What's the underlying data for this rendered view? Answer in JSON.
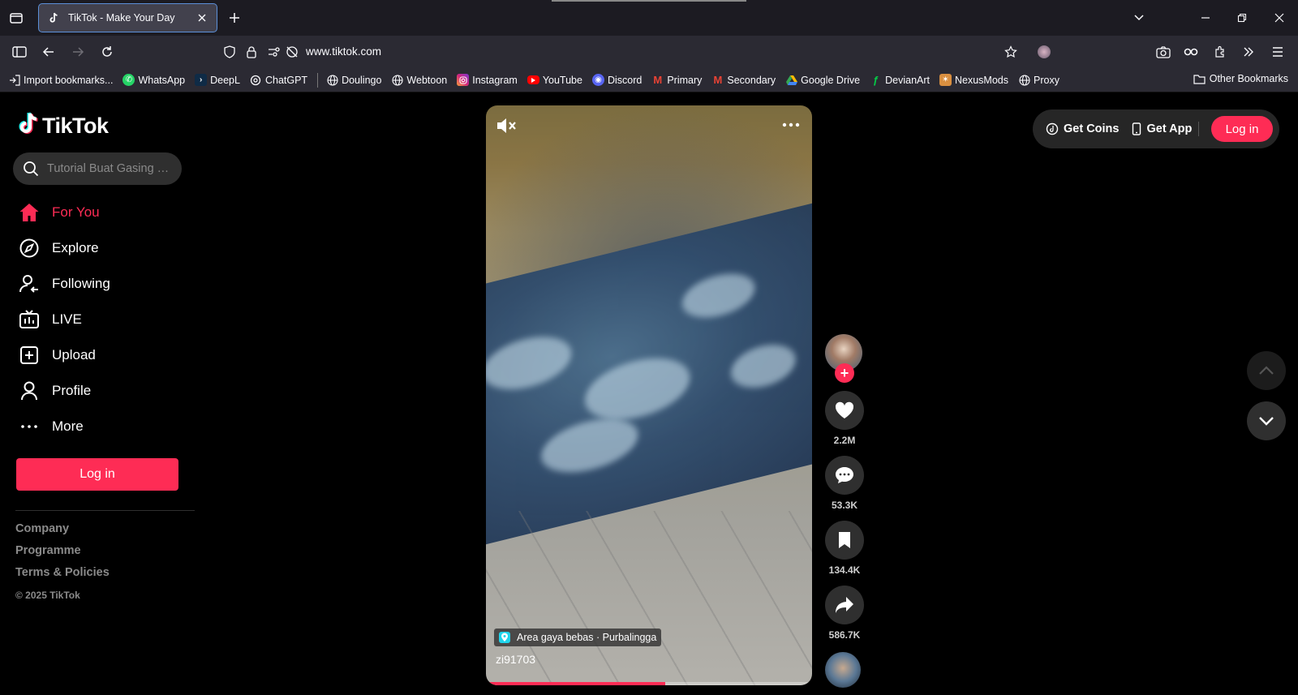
{
  "browser": {
    "tab_title": "TikTok - Make Your Day",
    "url": "www.tiktok.com",
    "bookmarks": [
      {
        "label": "Import bookmarks...",
        "icon": "import-icon"
      },
      {
        "label": "WhatsApp",
        "icon": "whatsapp-icon"
      },
      {
        "label": "DeepL",
        "icon": "deepl-icon"
      },
      {
        "label": "ChatGPT",
        "icon": "chatgpt-icon"
      },
      {
        "label": "Doulingo",
        "icon": "globe-icon"
      },
      {
        "label": "Webtoon",
        "icon": "globe-icon"
      },
      {
        "label": "Instagram",
        "icon": "instagram-icon"
      },
      {
        "label": "YouTube",
        "icon": "youtube-icon"
      },
      {
        "label": "Discord",
        "icon": "discord-icon"
      },
      {
        "label": "Primary",
        "icon": "gmail-icon"
      },
      {
        "label": "Secondary",
        "icon": "gmail-icon"
      },
      {
        "label": "Google Drive",
        "icon": "google-drive-icon"
      },
      {
        "label": "DevianArt",
        "icon": "deviantart-icon"
      },
      {
        "label": "NexusMods",
        "icon": "nexusmods-icon"
      },
      {
        "label": "Proxy",
        "icon": "globe-icon"
      }
    ],
    "other_bookmarks": "Other Bookmarks"
  },
  "sidebar": {
    "logo": "TikTok",
    "search_placeholder": "Tutorial Buat Gasing P...",
    "nav": [
      {
        "label": "For You",
        "icon": "home-icon",
        "active": true
      },
      {
        "label": "Explore",
        "icon": "compass-icon"
      },
      {
        "label": "Following",
        "icon": "following-icon"
      },
      {
        "label": "LIVE",
        "icon": "live-icon"
      },
      {
        "label": "Upload",
        "icon": "upload-icon"
      },
      {
        "label": "Profile",
        "icon": "profile-icon"
      },
      {
        "label": "More",
        "icon": "more-icon"
      }
    ],
    "login": "Log in",
    "footer": {
      "links": [
        "Company",
        "Programme",
        "Terms & Policies"
      ],
      "copyright": "© 2025 TikTok"
    }
  },
  "video": {
    "location": "Area gaya bebas · Purbalingga",
    "username": "zi91703",
    "progress": 0.55
  },
  "actions": {
    "likes": "2.2M",
    "comments": "53.3K",
    "saves": "134.4K",
    "shares": "586.7K"
  },
  "topright": {
    "coins": "Get Coins",
    "app": "Get App",
    "login": "Log in"
  },
  "colors": {
    "accent": "#fe2c55",
    "background": "#000000"
  }
}
